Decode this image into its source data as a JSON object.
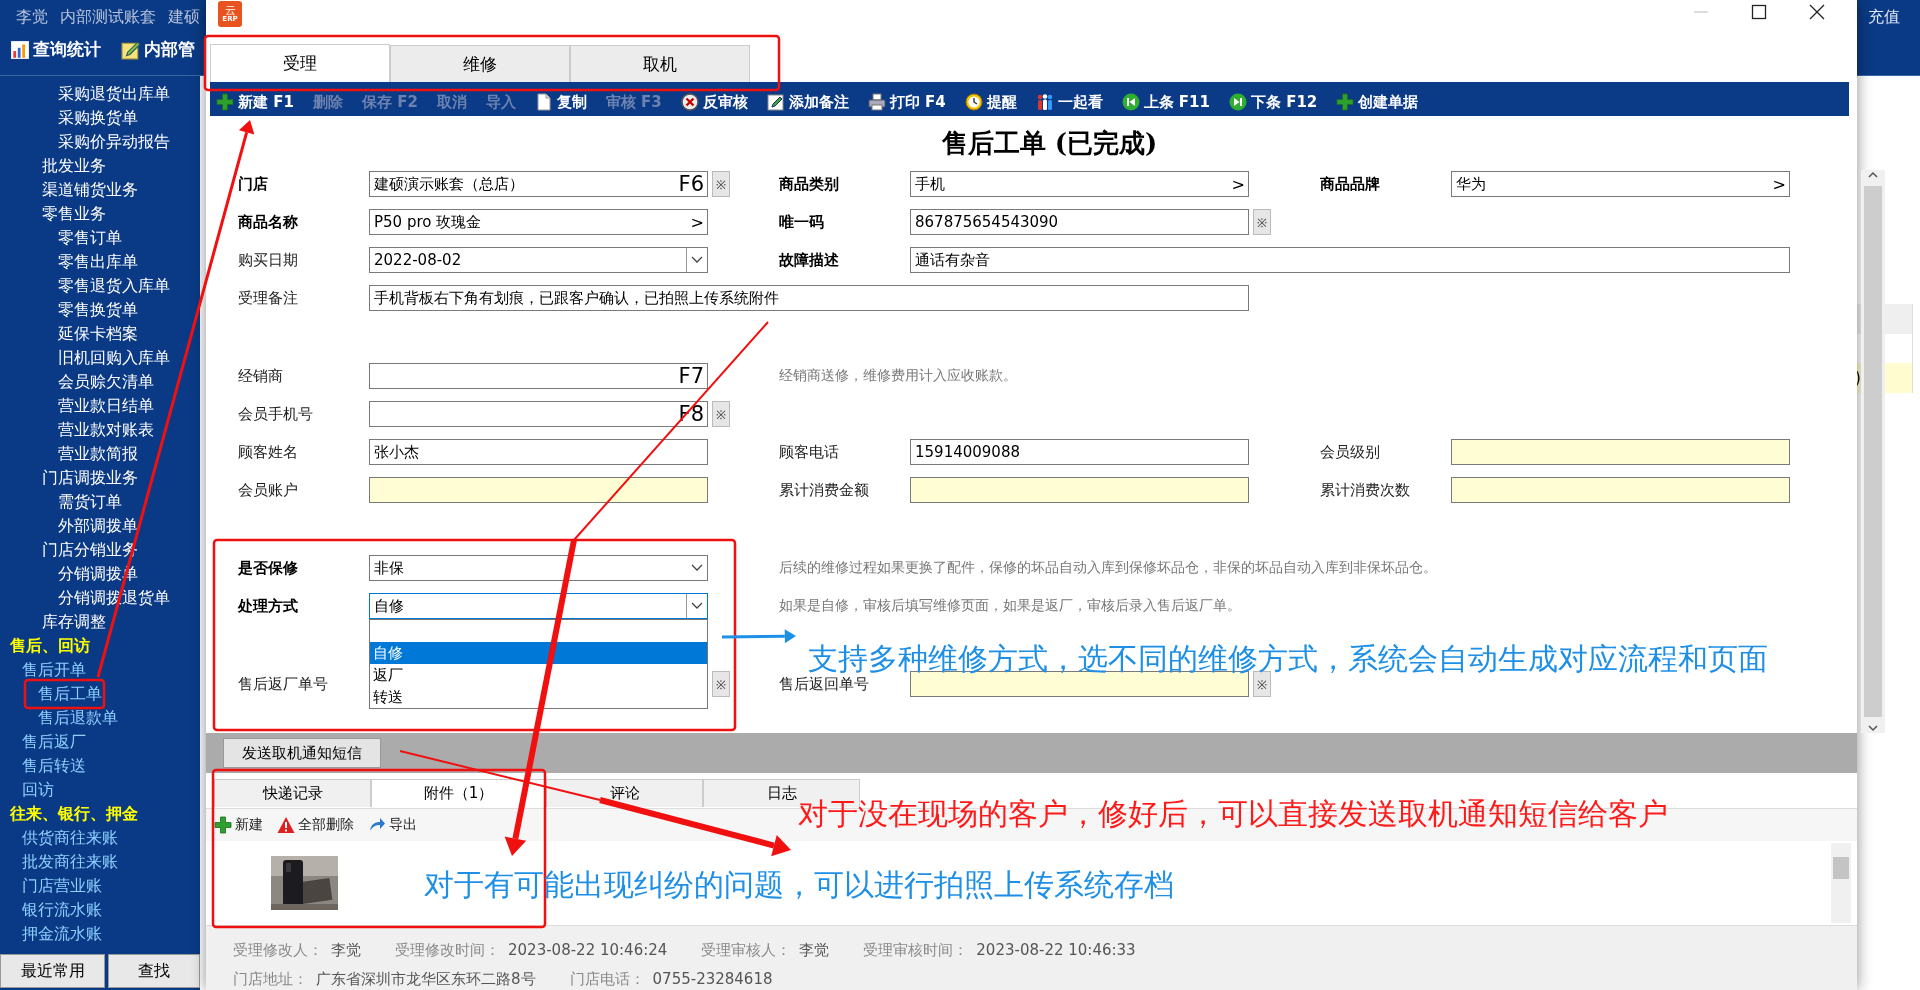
{
  "header": {
    "user": "李觉",
    "account": "内部测试账套",
    "company": "建硕",
    "right_text": "充值",
    "nav": [
      {
        "label": "查询统计"
      },
      {
        "label": "内部管"
      }
    ]
  },
  "sidebar": {
    "continued": [
      "采购退货出库单",
      "采购换货单",
      "采购价异动报告"
    ],
    "items": [
      {
        "label": "批发业务",
        "kind": "item"
      },
      {
        "label": "渠道铺货业务",
        "kind": "item"
      },
      {
        "label": "零售业务",
        "kind": "item",
        "children": [
          {
            "label": "零售订单"
          },
          {
            "label": "零售出库单"
          },
          {
            "label": "零售退货入库单"
          },
          {
            "label": "零售换货单"
          },
          {
            "label": "延保卡档案"
          },
          {
            "label": "旧机回购入库单"
          },
          {
            "label": "会员赊欠清单"
          },
          {
            "label": "营业款日结单"
          },
          {
            "label": "营业款对账表"
          },
          {
            "label": "营业款简报"
          }
        ]
      },
      {
        "label": "门店调拨业务",
        "kind": "item",
        "children": [
          {
            "label": "需货订单"
          },
          {
            "label": "外部调拨单"
          }
        ]
      },
      {
        "label": "门店分销业务",
        "kind": "item",
        "children": [
          {
            "label": "分销调拨单"
          },
          {
            "label": "分销调拨退货单"
          }
        ]
      },
      {
        "label": "库存调整",
        "kind": "item"
      },
      {
        "label": "售后、回访",
        "kind": "header",
        "children": [
          {
            "label": "售后开单",
            "children": [
              {
                "label": "售后工单"
              },
              {
                "label": "售后退款单"
              }
            ]
          },
          {
            "label": "售后返厂"
          },
          {
            "label": "售后转送"
          },
          {
            "label": "回访"
          }
        ]
      },
      {
        "label": "往来、银行、押金",
        "kind": "header",
        "children": [
          {
            "label": "供货商往来账"
          },
          {
            "label": "批发商往来账"
          },
          {
            "label": "门店营业账"
          },
          {
            "label": "银行流水账"
          },
          {
            "label": "押金流水账"
          }
        ]
      }
    ],
    "buttons": [
      "最近常用",
      "查找"
    ]
  },
  "side_panel": {
    "row_text": ")"
  },
  "dialog": {
    "logo": {
      "top": "云",
      "bottom": "ERP"
    },
    "stage_tabs": [
      {
        "label": "受理",
        "selected": true
      },
      {
        "label": "维修",
        "selected": false
      },
      {
        "label": "取机",
        "selected": false
      }
    ],
    "toolbar": [
      {
        "label": "新建 F1",
        "disabled": false
      },
      {
        "label": "删除",
        "disabled": true
      },
      {
        "label": "保存 F2",
        "disabled": true
      },
      {
        "label": "取消",
        "disabled": true
      },
      {
        "label": "导入",
        "disabled": true
      },
      {
        "label": "复制",
        "disabled": false
      },
      {
        "label": "审核 F3",
        "disabled": true
      },
      {
        "label": "反审核",
        "disabled": false
      },
      {
        "label": "添加备注",
        "disabled": false
      },
      {
        "label": "打印 F4",
        "disabled": false
      },
      {
        "label": "提醒",
        "disabled": false
      },
      {
        "label": "一起看",
        "disabled": false
      },
      {
        "label": "上条 F11",
        "disabled": false
      },
      {
        "label": "下条 F12",
        "disabled": false
      },
      {
        "label": "创建单据",
        "disabled": false
      }
    ],
    "title": "售后工单 (已完成)",
    "form": {
      "groups": [
        [
          [
            {
              "label": "门店",
              "bold": true,
              "kind": "text",
              "value": "建硕演示账套（总店）",
              "suffix": "F6",
              "star": "※",
              "readonly": false
            },
            {
              "label": "商品类别",
              "bold": true,
              "kind": "text",
              "value": "手机",
              "suffix": ">",
              "readonly": false
            },
            {
              "label": "商品品牌",
              "bold": true,
              "kind": "text",
              "value": "华为",
              "suffix": ">",
              "readonly": false
            }
          ],
          [
            {
              "label": "商品名称",
              "bold": true,
              "kind": "text",
              "value": "P50 pro 玫瑰金",
              "suffix": ">",
              "readonly": false
            },
            {
              "label": "唯一码",
              "bold": true,
              "kind": "text",
              "value": "867875654543090",
              "star": "※",
              "readonly": false
            }
          ],
          [
            {
              "label": "购买日期",
              "bold": false,
              "kind": "date",
              "value": "2022-08-02",
              "readonly": false
            },
            {
              "label": "故障描述",
              "bold": true,
              "kind": "wide",
              "value": "通话有杂音",
              "readonly": false
            }
          ],
          [
            {
              "label": "受理备注",
              "bold": false,
              "kind": "memo",
              "value": "手机背板右下角有划痕，已跟客户确认，已拍照上传系统附件",
              "readonly": false
            }
          ]
        ],
        [
          [
            {
              "label": "经销商",
              "bold": false,
              "kind": "text",
              "suffix": "F7",
              "readonly": false
            },
            {
              "kind": "hint",
              "text": "经销商送修，维修费用计入应收账款。"
            }
          ],
          [
            {
              "label": "会员手机号",
              "bold": false,
              "kind": "text",
              "suffix": "F8",
              "star": "※",
              "readonly": false
            }
          ],
          [
            {
              "label": "顾客姓名",
              "bold": false,
              "kind": "text",
              "value": "张小杰",
              "readonly": false
            },
            {
              "label": "顾客电话",
              "bold": false,
              "kind": "text",
              "value": "15914009088",
              "readonly": false
            },
            {
              "label": "会员级别",
              "bold": false,
              "kind": "text",
              "readonly": true
            }
          ],
          [
            {
              "label": "会员账户",
              "bold": false,
              "kind": "text",
              "readonly": true
            },
            {
              "label": "累计消费金额",
              "bold": false,
              "kind": "text",
              "readonly": true
            },
            {
              "label": "累计消费次数",
              "bold": false,
              "kind": "text",
              "readonly": true
            }
          ]
        ],
        [
          [
            {
              "label": "是否保修",
              "bold": true,
              "kind": "select",
              "value": "非保",
              "readonly": false
            },
            {
              "kind": "hint",
              "text": "后续的维修过程如果更换了配件，保修的坏品自动入库到保修坏品仓，非保的坏品自动入库到非保坏品仓。"
            }
          ],
          [
            {
              "label": "处理方式",
              "bold": true,
              "kind": "select",
              "value": "自修",
              "readonly": false,
              "options": [
                {
                  "label": "自修",
                  "selected": true
                },
                {
                  "label": "返厂",
                  "selected": false
                },
                {
                  "label": "转送",
                  "selected": false
                }
              ]
            },
            {
              "kind": "hint",
              "text": "如果是自修，审核后填写维修页面，如果是返厂，审核后录入售后返厂单。"
            }
          ]
        ],
        [
          [
            {
              "label": "售后返厂单号",
              "bold": false,
              "kind": "covered",
              "star": "※"
            },
            {
              "label": "售后返回单号",
              "bold": false,
              "kind": "text",
              "star": "※",
              "readonly": true
            }
          ]
        ]
      ]
    },
    "send_button": "发送取机通知短信",
    "detail_tabs": [
      {
        "label": "快递记录",
        "selected": false
      },
      {
        "label": "附件（1）",
        "selected": true
      },
      {
        "label": "评论",
        "selected": false
      },
      {
        "label": "日志",
        "selected": false
      }
    ],
    "detail_toolbar": [
      {
        "label": "新建"
      },
      {
        "label": "全部删除"
      },
      {
        "label": "导出"
      }
    ],
    "attachments": [
      {
        "kind": "picture"
      }
    ],
    "footer": [
      [
        {
          "label": "受理修改人：",
          "value": "李觉"
        },
        {
          "label": "受理修改时间：",
          "value": "2023-08-22 10:46:24"
        },
        {
          "label": "受理审核人：",
          "value": "李觉"
        },
        {
          "label": "受理审核时间：",
          "value": "2023-08-22 10:46:33"
        }
      ],
      [
        {
          "label": "门店地址：",
          "value": "广东省深圳市龙华区东环二路8号"
        },
        {
          "label": "门店电话：",
          "value": "0755-23284618"
        }
      ]
    ]
  },
  "annotations": [
    {
      "text": "支持多种维修方式，选不同的维修方式，系统会自动生成对应流程和页面",
      "color": "#1e8fe6"
    },
    {
      "text": "对于没在现场的客户，修好后，可以直接发送取机通知短信给客户",
      "color": "#ff1a1a"
    },
    {
      "text": "对于有可能出现纠纷的问题，可以进行拍照上传系统存档",
      "color": "#1e8fe6"
    }
  ]
}
